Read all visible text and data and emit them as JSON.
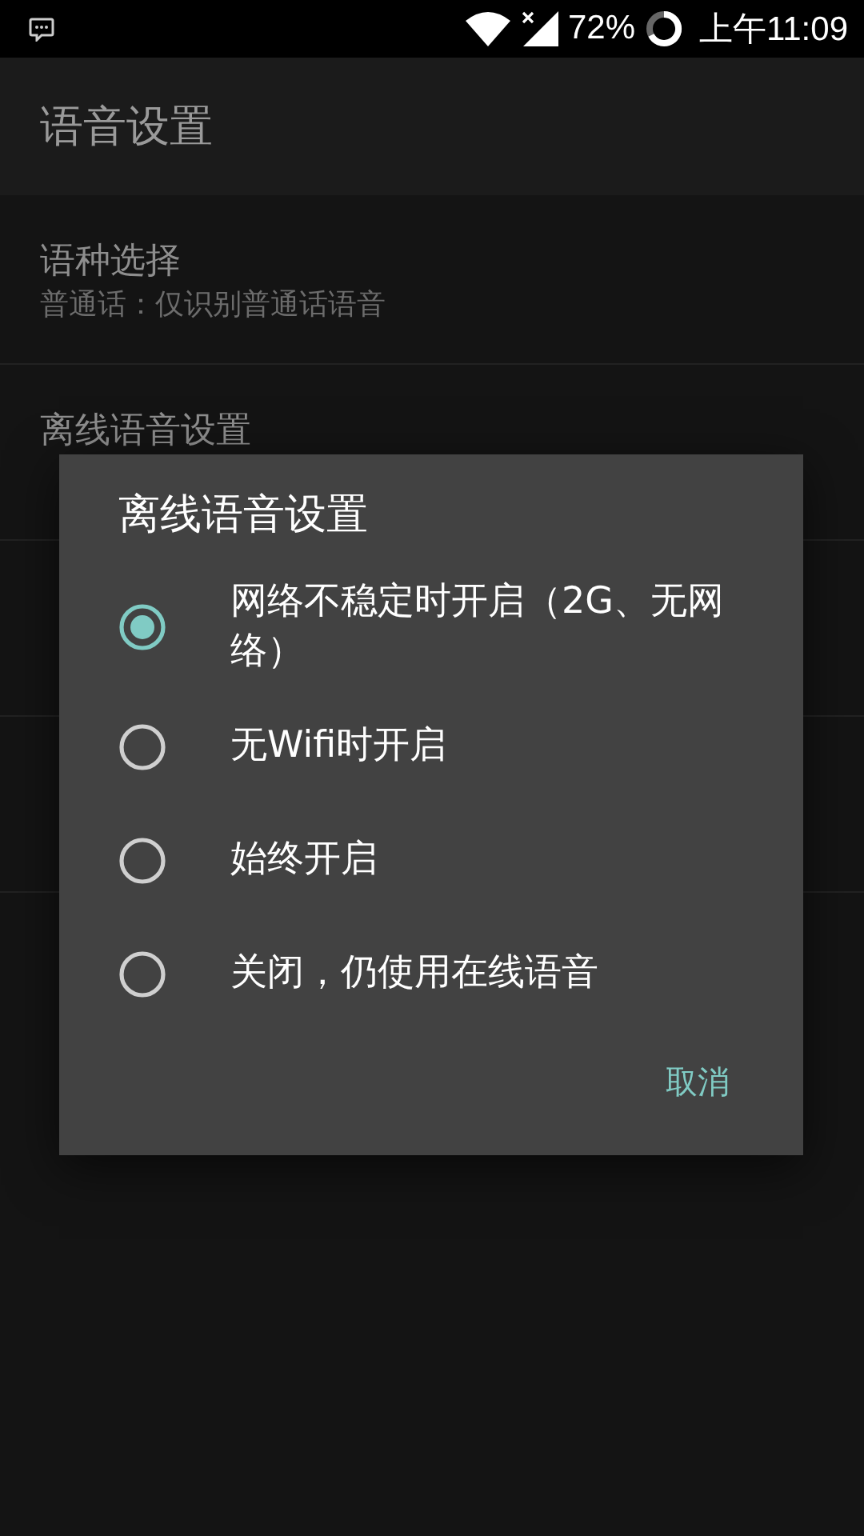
{
  "status_bar": {
    "battery": "72%",
    "time": "上午11:09"
  },
  "app_bar": {
    "title": "语音设置"
  },
  "settings": [
    {
      "title": "语种选择",
      "summary": "普通话：仅识别普通话语音"
    },
    {
      "title": "离线语音设置"
    }
  ],
  "dialog": {
    "title": "离线语音设置",
    "options": [
      {
        "label": "网络不稳定时开启（2G、无网络）",
        "selected": true
      },
      {
        "label": "无Wifi时开启",
        "selected": false
      },
      {
        "label": "始终开启",
        "selected": false
      },
      {
        "label": "关闭，仍使用在线语音",
        "selected": false
      }
    ],
    "cancel": "取消"
  }
}
